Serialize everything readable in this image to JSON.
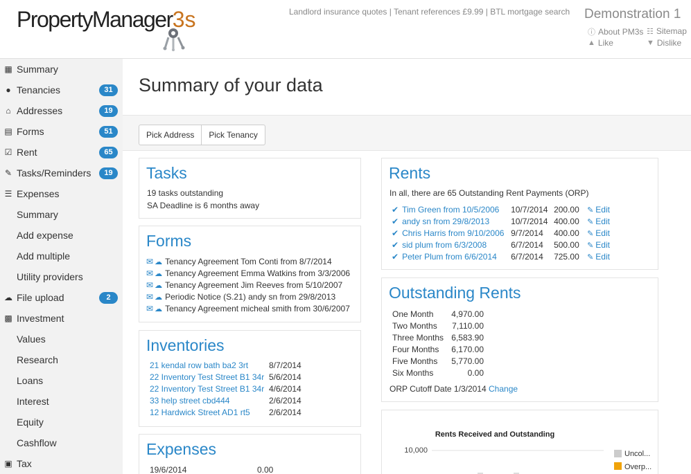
{
  "header": {
    "logo_main": "PropertyManager",
    "logo_accent": "3s",
    "top_links": "Landlord insurance quotes | Tenant references £9.99 | BTL mortgage search",
    "account_name": "Demonstration 1",
    "about": "About PM3s",
    "sitemap": "Sitemap",
    "like": "Like",
    "dislike": "Dislike"
  },
  "sidebar": {
    "items": [
      {
        "label": "Summary",
        "icon": "grid-icon"
      },
      {
        "label": "Tenancies",
        "icon": "user-icon",
        "badge": "31"
      },
      {
        "label": "Addresses",
        "icon": "home-icon",
        "badge": "19"
      },
      {
        "label": "Forms",
        "icon": "document-icon",
        "badge": "51"
      },
      {
        "label": "Rent",
        "icon": "check-square-icon",
        "badge": "65"
      },
      {
        "label": "Tasks/Reminders",
        "icon": "edit-icon",
        "badge": "19"
      },
      {
        "label": "Expenses",
        "icon": "list-icon"
      },
      {
        "label": "Summary"
      },
      {
        "label": "Add expense"
      },
      {
        "label": "Add multiple"
      },
      {
        "label": "Utility providers"
      },
      {
        "label": "File upload",
        "icon": "cloud-upload-icon",
        "badge": "2"
      },
      {
        "label": "Investment",
        "icon": "bar-chart-icon"
      },
      {
        "label": "Values"
      },
      {
        "label": "Research"
      },
      {
        "label": "Loans"
      },
      {
        "label": "Interest"
      },
      {
        "label": "Equity"
      },
      {
        "label": "Cashflow"
      },
      {
        "label": "Tax",
        "icon": "briefcase-icon"
      }
    ]
  },
  "main": {
    "title": "Summary of your data",
    "pick_address": "Pick Address",
    "pick_tenancy": "Pick Tenancy"
  },
  "tasks": {
    "title": "Tasks",
    "line1": "19 tasks outstanding",
    "line2": "SA Deadline is 6 months away"
  },
  "forms": {
    "title": "Forms",
    "items": [
      "Tenancy Agreement Tom Conti from 8/7/2014",
      "Tenancy Agreement Emma Watkins from 3/3/2006",
      "Tenancy Agreement Jim Reeves from 5/10/2007",
      "Periodic Notice (S.21) andy sn from 29/8/2013",
      "Tenancy Agreement micheal smith from 30/6/2007"
    ]
  },
  "inventories": {
    "title": "Inventories",
    "rows": [
      {
        "name": "21 kendal row bath ba2 3rt",
        "date": "8/7/2014"
      },
      {
        "name": "22 Inventory Test Street B1 34r",
        "date": "5/6/2014"
      },
      {
        "name": "22 Inventory Test Street B1 34r",
        "date": "4/6/2014"
      },
      {
        "name": "33 help street cbd444",
        "date": "2/6/2014"
      },
      {
        "name": "12 Hardwick Street AD1 rt5",
        "date": "2/6/2014"
      }
    ]
  },
  "expenses": {
    "title": "Expenses",
    "rows": [
      {
        "date": "19/6/2014",
        "amount": "0.00"
      }
    ]
  },
  "rents": {
    "title": "Rents",
    "summary": "In all, there are 65 Outstanding Rent Payments (ORP)",
    "edit_label": "Edit",
    "rows": [
      {
        "name": "Tim Green from 10/5/2006",
        "date": "10/7/2014",
        "amount": "200.00"
      },
      {
        "name": "andy sn from 29/8/2013",
        "date": "10/7/2014",
        "amount": "400.00"
      },
      {
        "name": "Chris Harris from 9/10/2006",
        "date": "9/7/2014",
        "amount": "400.00"
      },
      {
        "name": "sid plum from 6/3/2008",
        "date": "6/7/2014",
        "amount": "500.00"
      },
      {
        "name": "Peter Plum from 6/6/2014",
        "date": "6/7/2014",
        "amount": "725.00"
      }
    ]
  },
  "outstanding": {
    "title": "Outstanding Rents",
    "rows": [
      {
        "label": "One Month",
        "value": "4,970.00"
      },
      {
        "label": "Two Months",
        "value": "7,110.00"
      },
      {
        "label": "Three Months",
        "value": "6,583.90"
      },
      {
        "label": "Four Months",
        "value": "6,170.00"
      },
      {
        "label": "Five Months",
        "value": "5,770.00"
      },
      {
        "label": "Six Months",
        "value": "0.00"
      }
    ],
    "cutoff": "ORP Cutoff Date 1/3/2014",
    "change": "Change"
  },
  "chart_data": {
    "type": "bar",
    "title": "Rents Received and Outstanding",
    "y_tick_labels": [
      "10,000"
    ],
    "series": [
      {
        "name": "Uncol...",
        "color": "#cccccc"
      },
      {
        "name": "Overp...",
        "color": "#f0a30a"
      }
    ]
  }
}
